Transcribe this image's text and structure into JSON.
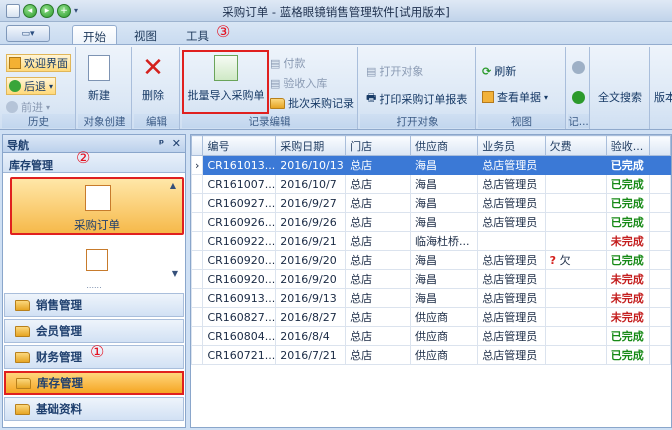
{
  "window": {
    "title": "采购订单 - 蓝格眼镜销售管理软件[试用版本]"
  },
  "tabs": [
    "开始",
    "视图",
    "工具"
  ],
  "ribbon": {
    "group_history": {
      "label": "历史",
      "welcome": "欢迎界面",
      "back": "后退",
      "forward": "前进"
    },
    "group_create": {
      "label": "对象创建",
      "new": "新建"
    },
    "group_edit": {
      "label": "编辑",
      "delete": "删除"
    },
    "group_record": {
      "label": "记录编辑",
      "batch_import": "批量导入采购单",
      "pay": "付款",
      "receive": "验收入库",
      "batch_record": "批次采购记录"
    },
    "group_open": {
      "label": "打开对象",
      "open": "打开对象",
      "print": "打印采购订单报表"
    },
    "group_view": {
      "label": "视图",
      "refresh": "刷新",
      "view_data": "查看单据"
    },
    "group_rec2": {
      "label": "记..."
    },
    "group_search": {
      "label": "",
      "all_search": "全文搜索"
    },
    "group_version": {
      "label": "",
      "version": "版本"
    }
  },
  "annotations": [
    "①",
    "②",
    "③"
  ],
  "nav": {
    "title": "导航",
    "pin": "ᵖ",
    "close": "✕",
    "section": "库存管理",
    "big_item": "采购订单",
    "more": "......",
    "items": [
      "销售管理",
      "会员管理",
      "财务管理",
      "库存管理",
      "基础资料"
    ]
  },
  "grid": {
    "columns": [
      "编号",
      "采购日期",
      "门店",
      "供应商",
      "业务员",
      "欠费",
      "验收...",
      ""
    ],
    "rows": [
      [
        "CR161013...",
        "2016/10/13",
        "总店",
        "海昌",
        "总店管理员",
        "",
        "已完成"
      ],
      [
        "CR161007...",
        "2016/10/7",
        "总店",
        "海昌",
        "总店管理员",
        "",
        "已完成"
      ],
      [
        "CR160927...",
        "2016/9/27",
        "总店",
        "海昌",
        "总店管理员",
        "",
        "已完成"
      ],
      [
        "CR160926...",
        "2016/9/26",
        "总店",
        "海昌",
        "总店管理员",
        "",
        "已完成"
      ],
      [
        "CR160922...",
        "2016/9/21",
        "总店",
        "临海杜桥...",
        "",
        "",
        "未完成"
      ],
      [
        "CR160920...",
        "2016/9/20",
        "总店",
        "海昌",
        "总店管理员",
        "欠",
        "已完成"
      ],
      [
        "CR160920...",
        "2016/9/20",
        "总店",
        "海昌",
        "总店管理员",
        "",
        "未完成"
      ],
      [
        "CR160913...",
        "2016/9/13",
        "总店",
        "海昌",
        "总店管理员",
        "",
        "未完成"
      ],
      [
        "CR160827...",
        "2016/8/27",
        "总店",
        "供应商",
        "总店管理员",
        "",
        "未完成"
      ],
      [
        "CR160804...",
        "2016/8/4",
        "总店",
        "供应商",
        "总店管理员",
        "",
        "已完成"
      ],
      [
        "CR160721...",
        "2016/7/21",
        "总店",
        "供应商",
        "总店管理员",
        "",
        "已完成"
      ]
    ]
  }
}
